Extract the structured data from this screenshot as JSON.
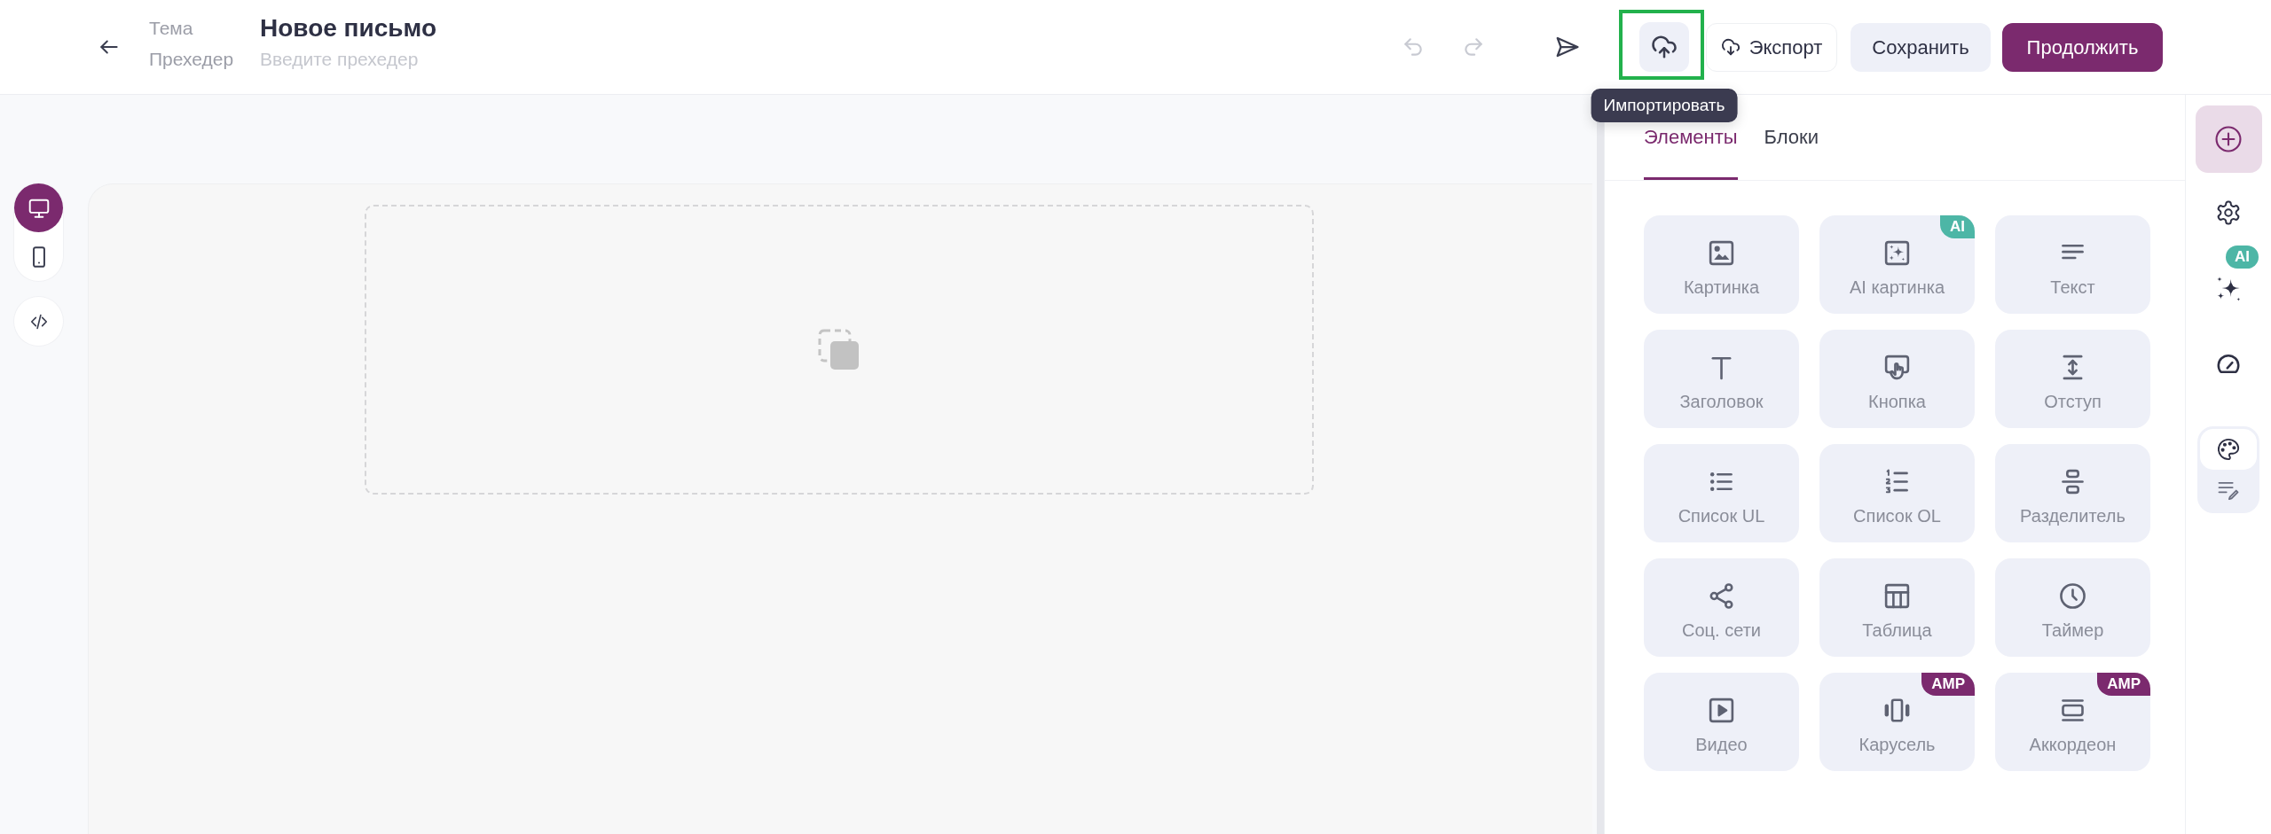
{
  "header": {
    "subject": {
      "label": "Тема",
      "value": "Новое письмо"
    },
    "preheader": {
      "label": "Прехедер",
      "placeholder": "Введите прехедер"
    }
  },
  "toolbar": {
    "history": [
      {
        "kind": "undo",
        "disabled": true
      },
      {
        "kind": "redo",
        "disabled": true
      }
    ],
    "import": {
      "tooltip": "Импортировать",
      "highlighted": true
    },
    "actions": [
      {
        "kind": "export",
        "label": "Экспорт"
      },
      {
        "kind": "save",
        "label": "Сохранить"
      },
      {
        "kind": "continue",
        "label": "Продолжить"
      }
    ]
  },
  "view_modes": [
    {
      "kind": "desktop",
      "selected": true
    },
    {
      "kind": "mobile",
      "selected": false
    }
  ],
  "panel": {
    "tabs": [
      {
        "label": "Элементы",
        "selected": true
      },
      {
        "label": "Блоки",
        "selected": false
      }
    ],
    "elements": [
      {
        "kind": "image",
        "label": "Картинка"
      },
      {
        "kind": "ai_image",
        "label": "AI картинка",
        "badge": {
          "text": "AI",
          "color": "#4db6a6"
        }
      },
      {
        "kind": "text",
        "label": "Текст"
      },
      {
        "kind": "heading",
        "label": "Заголовок"
      },
      {
        "kind": "button",
        "label": "Кнопка"
      },
      {
        "kind": "spacer",
        "label": "Отступ"
      },
      {
        "kind": "list_ul",
        "label": "Список UL"
      },
      {
        "kind": "list_ol",
        "label": "Список OL"
      },
      {
        "kind": "divider",
        "label": "Разделитель"
      },
      {
        "kind": "social",
        "label": "Соц. сети"
      },
      {
        "kind": "table",
        "label": "Таблица"
      },
      {
        "kind": "timer",
        "label": "Таймер"
      },
      {
        "kind": "video",
        "label": "Видео"
      },
      {
        "kind": "carousel",
        "label": "Карусель",
        "badge": {
          "text": "AMP",
          "color": "#7b2a6e"
        }
      },
      {
        "kind": "accordion",
        "label": "Аккордеон",
        "badge": {
          "text": "AMP",
          "color": "#7b2a6e"
        }
      }
    ]
  },
  "sidebar": {
    "tools": [
      {
        "kind": "add",
        "selected": true
      },
      {
        "kind": "settings",
        "selected": false
      },
      {
        "kind": "ai",
        "selected": false,
        "badge": "AI"
      },
      {
        "kind": "speed",
        "selected": false
      }
    ],
    "style_modes": [
      {
        "kind": "palette",
        "selected": true
      },
      {
        "kind": "text_style",
        "selected": false
      }
    ]
  }
}
